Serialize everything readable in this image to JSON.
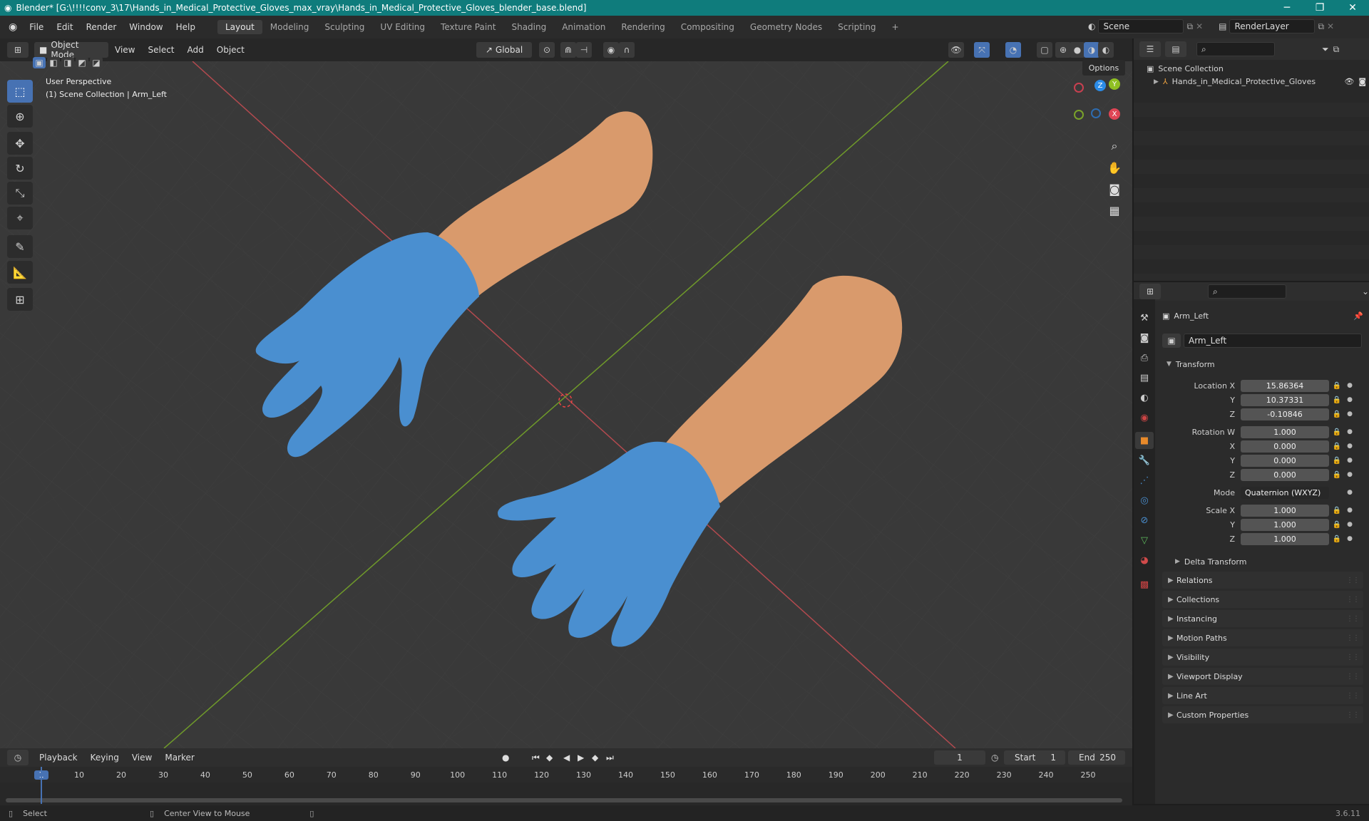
{
  "titlebar": {
    "title": "Blender* [G:\\!!!!conv_3\\17\\Hands_in_Medical_Protective_Gloves_max_vray\\Hands_in_Medical_Protective_Gloves_blender_base.blend]",
    "minimize": "─",
    "restore": "❐",
    "close": "✕"
  },
  "topbar": {
    "menus": [
      "File",
      "Edit",
      "Render",
      "Window",
      "Help"
    ],
    "workspaces": [
      "Layout",
      "Modeling",
      "Sculpting",
      "UV Editing",
      "Texture Paint",
      "Shading",
      "Animation",
      "Rendering",
      "Compositing",
      "Geometry Nodes",
      "Scripting"
    ],
    "active_workspace": "Layout",
    "add_tab": "+",
    "scene": "Scene",
    "view_layer": "RenderLayer"
  },
  "viewport_header": {
    "mode": "Object Mode",
    "menus": [
      "View",
      "Select",
      "Add",
      "Object"
    ],
    "orientation": "Global",
    "options": "Options"
  },
  "viewport": {
    "perspective": "User Perspective",
    "context": "(1) Scene Collection | Arm_Left",
    "gizmo": {
      "x": "X",
      "y": "Y",
      "z": "Z"
    },
    "colors": {
      "bg": "#393939",
      "glove": "#4a8fd0",
      "skin": "#d99a6c",
      "x_axis": "#b34a4f",
      "y_axis": "#6f9a2a"
    }
  },
  "tools": [
    "select-box",
    "cursor",
    "move",
    "rotate",
    "scale",
    "transform",
    "annotate",
    "measure",
    "add-cube"
  ],
  "outliner": {
    "root": "Scene Collection",
    "items": [
      {
        "label": "Hands_in_Medical_Protective_Gloves"
      }
    ]
  },
  "properties": {
    "object_name": "Arm_Left",
    "object_field": "Arm_Left",
    "transform_label": "Transform",
    "rows": [
      {
        "label": "Location X",
        "value": "15.86364"
      },
      {
        "label": "Y",
        "value": "10.37331"
      },
      {
        "label": "Z",
        "value": "-0.10846"
      },
      {
        "label": "Rotation W",
        "value": "1.000"
      },
      {
        "label": "X",
        "value": "0.000"
      },
      {
        "label": "Y",
        "value": "0.000"
      },
      {
        "label": "Z",
        "value": "0.000"
      },
      {
        "label": "Scale X",
        "value": "1.000"
      },
      {
        "label": "Y",
        "value": "1.000"
      },
      {
        "label": "Z",
        "value": "1.000"
      }
    ],
    "mode_label": "Mode",
    "mode_value": "Quaternion (WXYZ)",
    "delta": "Delta Transform",
    "panels": [
      "Relations",
      "Collections",
      "Instancing",
      "Motion Paths",
      "Visibility",
      "Viewport Display",
      "Line Art",
      "Custom Properties"
    ]
  },
  "timeline": {
    "menus": [
      "Playback",
      "Keying",
      "View",
      "Marker"
    ],
    "current_frame": "1",
    "start_label": "Start",
    "start": "1",
    "end_label": "End",
    "end": "250",
    "ticks": [
      "1",
      "10",
      "20",
      "30",
      "40",
      "50",
      "60",
      "70",
      "80",
      "90",
      "100",
      "110",
      "120",
      "130",
      "140",
      "150",
      "160",
      "170",
      "180",
      "190",
      "200",
      "210",
      "220",
      "230",
      "240",
      "250"
    ]
  },
  "statusbar": {
    "select": "Select",
    "center": "Center View to Mouse",
    "version": "3.6.11"
  }
}
